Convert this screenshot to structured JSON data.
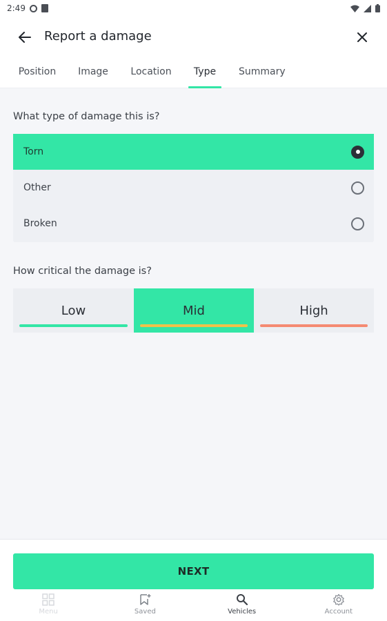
{
  "status_bar": {
    "time": "2:49"
  },
  "app_bar": {
    "title": "Report a damage"
  },
  "tabs": [
    {
      "label": "Position"
    },
    {
      "label": "Image"
    },
    {
      "label": "Location"
    },
    {
      "label": "Type",
      "active": true
    },
    {
      "label": "Summary"
    }
  ],
  "damage_type": {
    "question": "What type of damage this is?",
    "options": [
      {
        "label": "Torn",
        "selected": true
      },
      {
        "label": "Other",
        "selected": false
      },
      {
        "label": "Broken",
        "selected": false
      }
    ]
  },
  "severity": {
    "question": "How critical the damage is?",
    "levels": [
      {
        "label": "Low",
        "color": "#33e6a6",
        "selected": false
      },
      {
        "label": "Mid",
        "color": "#f0c24a",
        "selected": true
      },
      {
        "label": "High",
        "color": "#f58a72",
        "selected": false
      }
    ]
  },
  "next_button": {
    "label": "NEXT"
  },
  "bottom_nav": [
    {
      "label": "Menu",
      "icon": "grid-icon"
    },
    {
      "label": "Saved",
      "icon": "bookmark-icon"
    },
    {
      "label": "Vehicles",
      "icon": "search-icon",
      "active": true
    },
    {
      "label": "Account",
      "icon": "gear-icon"
    }
  ],
  "colors": {
    "accent": "#33e6a6"
  }
}
